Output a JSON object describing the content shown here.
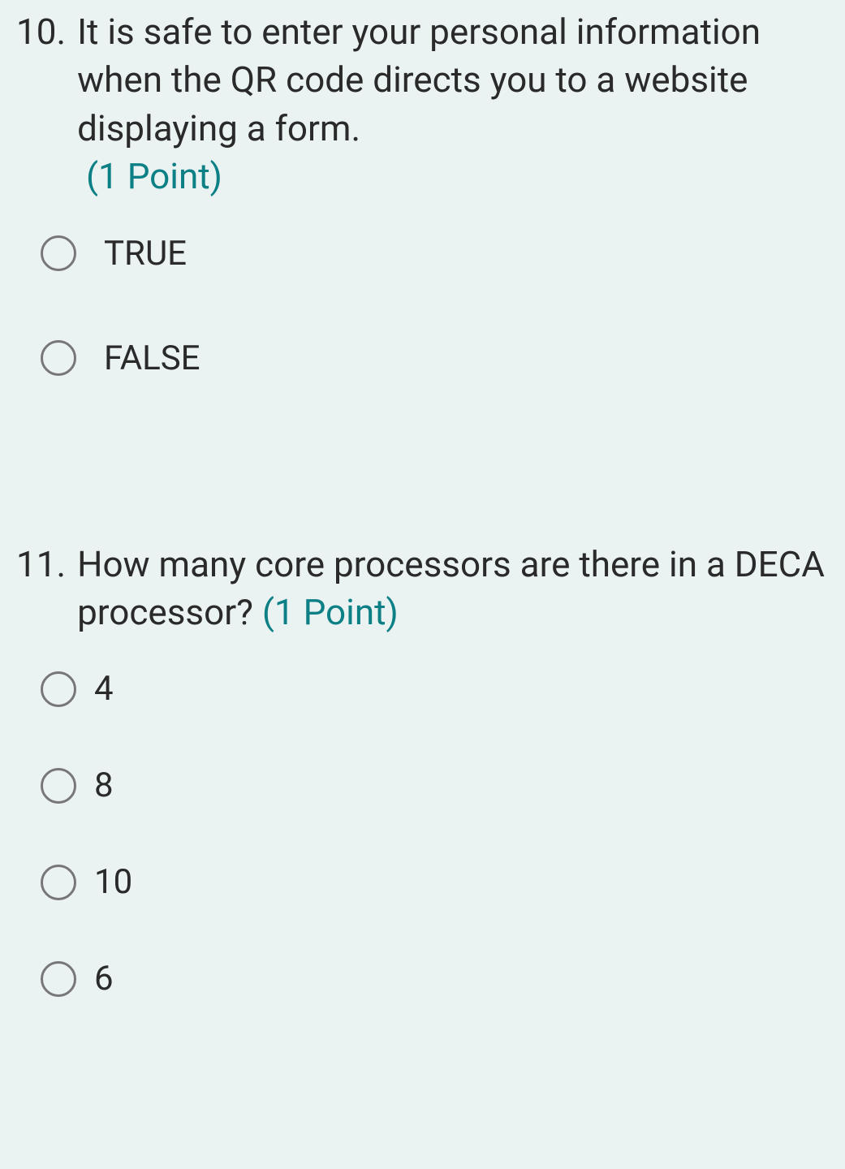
{
  "questions": [
    {
      "number": "10.",
      "text": "It is safe to enter your personal information when the QR code directs you to a website displaying a form.",
      "points": "(1 Point)",
      "options": [
        {
          "label": "TRUE"
        },
        {
          "label": "FALSE"
        }
      ]
    },
    {
      "number": "11.",
      "text": "How many core processors are there in a DECA processor?",
      "points": "(1 Point)",
      "options": [
        {
          "label": "4"
        },
        {
          "label": "8"
        },
        {
          "label": "10"
        },
        {
          "label": "6"
        }
      ]
    }
  ]
}
